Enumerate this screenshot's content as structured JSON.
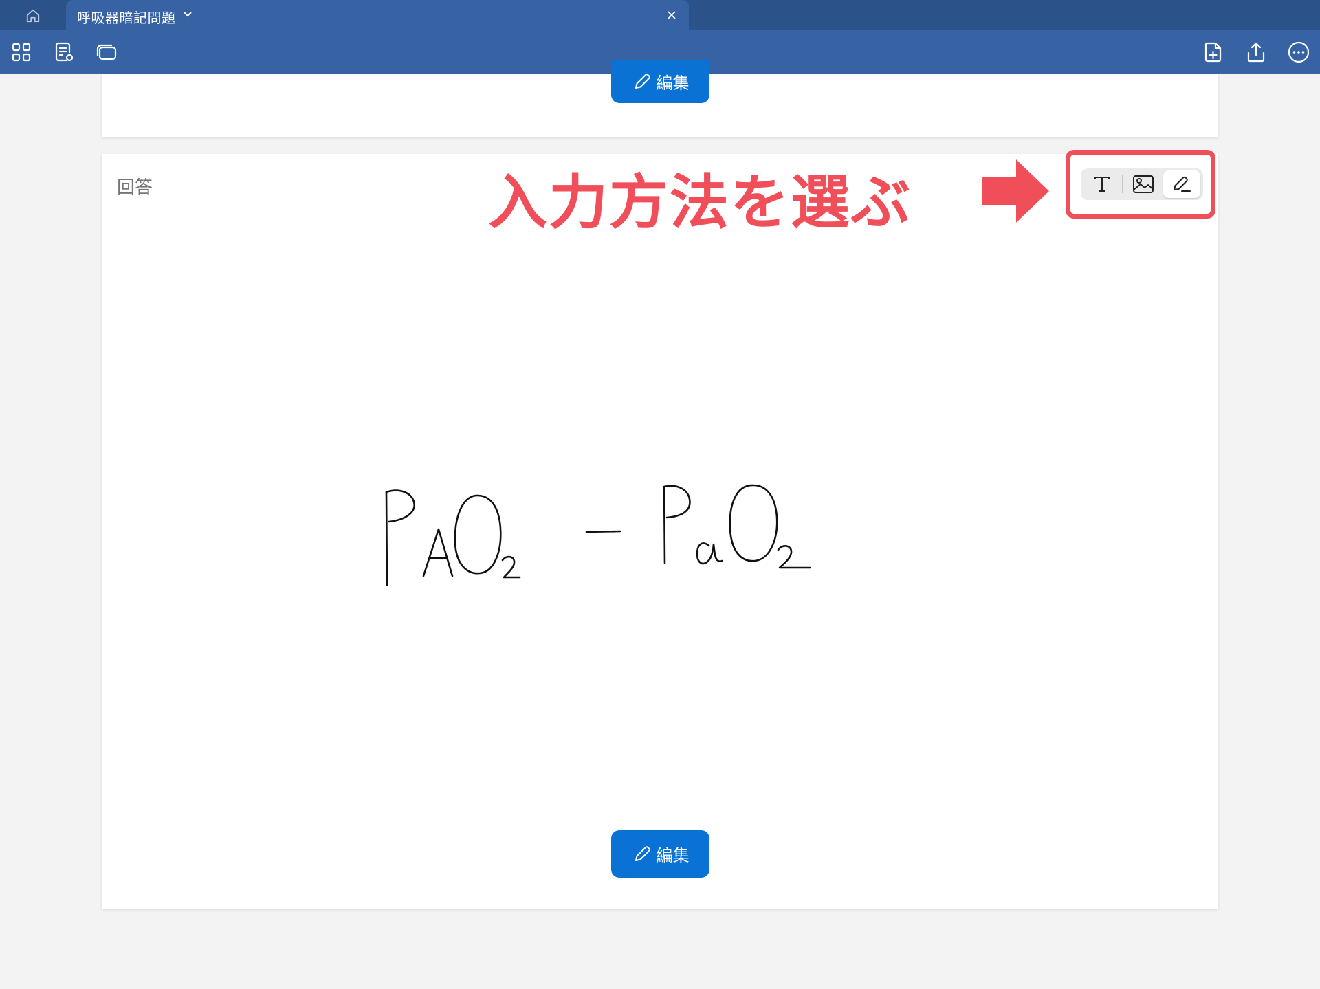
{
  "window": {
    "tab_title": "呼吸器暗記問題"
  },
  "icons": {
    "home": "home-icon",
    "tab_menu": "chevron-down-icon",
    "tab_close": "close-icon",
    "toolbar_left": [
      "grid-view-icon",
      "note-settings-icon",
      "cards-icon"
    ],
    "toolbar_right": [
      "add-page-icon",
      "share-icon",
      "more-icon"
    ]
  },
  "cards": {
    "top": {
      "edit_label": "編集"
    },
    "answer": {
      "label": "回答",
      "edit_label": "編集",
      "handwritten_content": "PAO2 − PaO2"
    }
  },
  "input_modes": {
    "options": [
      "text",
      "image",
      "pen"
    ],
    "selected": "pen"
  },
  "annotation": {
    "text": "入力方法を選ぶ",
    "color": "#f04e59"
  },
  "colors": {
    "tabbar": "#2b5289",
    "toolbar": "#3762a4",
    "edit_button": "#0a72d4",
    "background": "#f3f3f3"
  }
}
